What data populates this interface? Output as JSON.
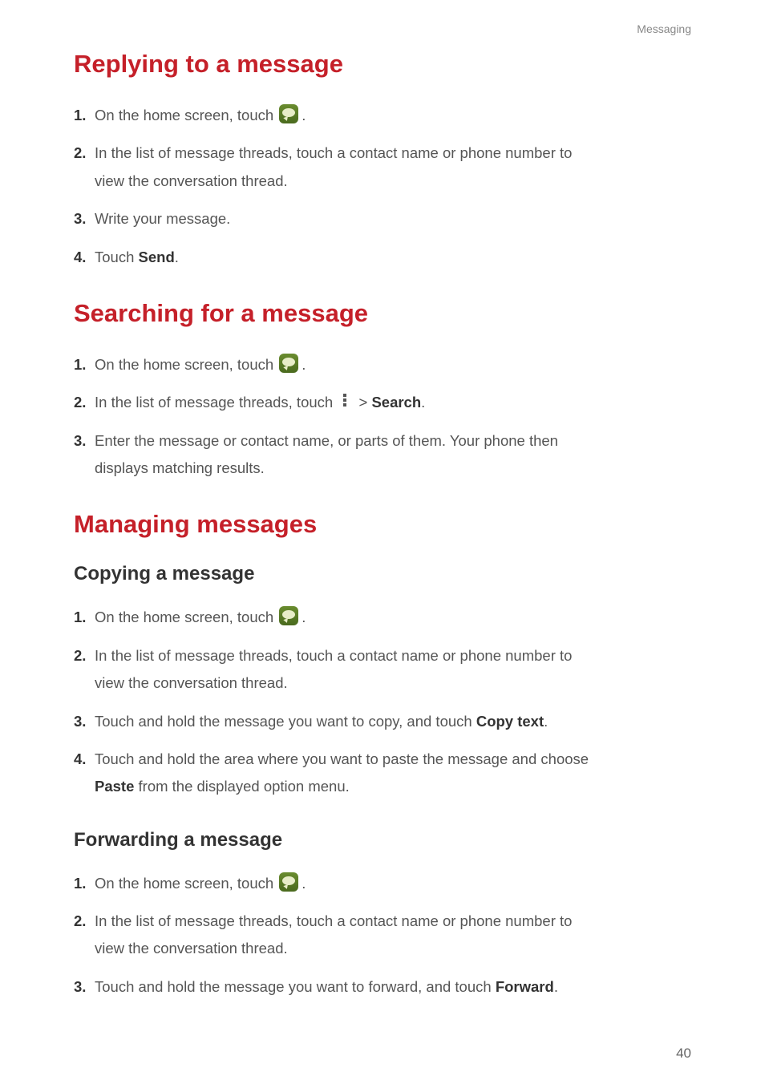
{
  "header": {
    "category": "Messaging"
  },
  "sections": [
    {
      "title": "Replying to a message",
      "steps": [
        {
          "prefix": "On the home screen, touch ",
          "icon": "msg",
          "suffix": "."
        },
        {
          "prefix": "In the list of message threads, touch a contact name or phone number to",
          "cont": "view the conversation thread."
        },
        {
          "prefix": "Write your message."
        },
        {
          "prefix": "Touch ",
          "bold1": "Send",
          "suffix": "."
        }
      ]
    },
    {
      "title": "Searching for a message",
      "steps": [
        {
          "prefix": "On the home screen, touch ",
          "icon": "msg",
          "suffix": "."
        },
        {
          "prefix": "In the list of message threads, touch ",
          "icon": "dots",
          "mid": " > ",
          "bold1": "Search",
          "suffix": "."
        },
        {
          "prefix": "Enter the message or contact name, or parts of them. Your phone then",
          "cont": "displays matching results."
        }
      ]
    },
    {
      "title": "Managing messages",
      "subsections": [
        {
          "subtitle": "Copying  a  message",
          "steps": [
            {
              "prefix": "On the home screen, touch ",
              "icon": "msg",
              "suffix": "."
            },
            {
              "prefix": "In the list of message threads, touch a contact name or phone number to",
              "cont": "view the conversation thread."
            },
            {
              "prefix": "Touch and hold the message you want to copy, and touch ",
              "bold1": "Copy text",
              "suffix": "."
            },
            {
              "prefix": "Touch and hold the area where you want to paste the message and choose",
              "cont_bold": "Paste",
              "cont_after": " from the displayed option menu."
            }
          ]
        },
        {
          "subtitle": "Forwarding  a  message",
          "steps": [
            {
              "prefix": "On the home screen, touch ",
              "icon": "msg",
              "suffix": "."
            },
            {
              "prefix": "In the list of message threads, touch a contact name or phone number to",
              "cont": "view the conversation thread."
            },
            {
              "prefix": "Touch and hold the message you want to forward, and touch ",
              "bold1": "Forward",
              "suffix": "."
            }
          ]
        }
      ]
    }
  ],
  "page_number": "40"
}
